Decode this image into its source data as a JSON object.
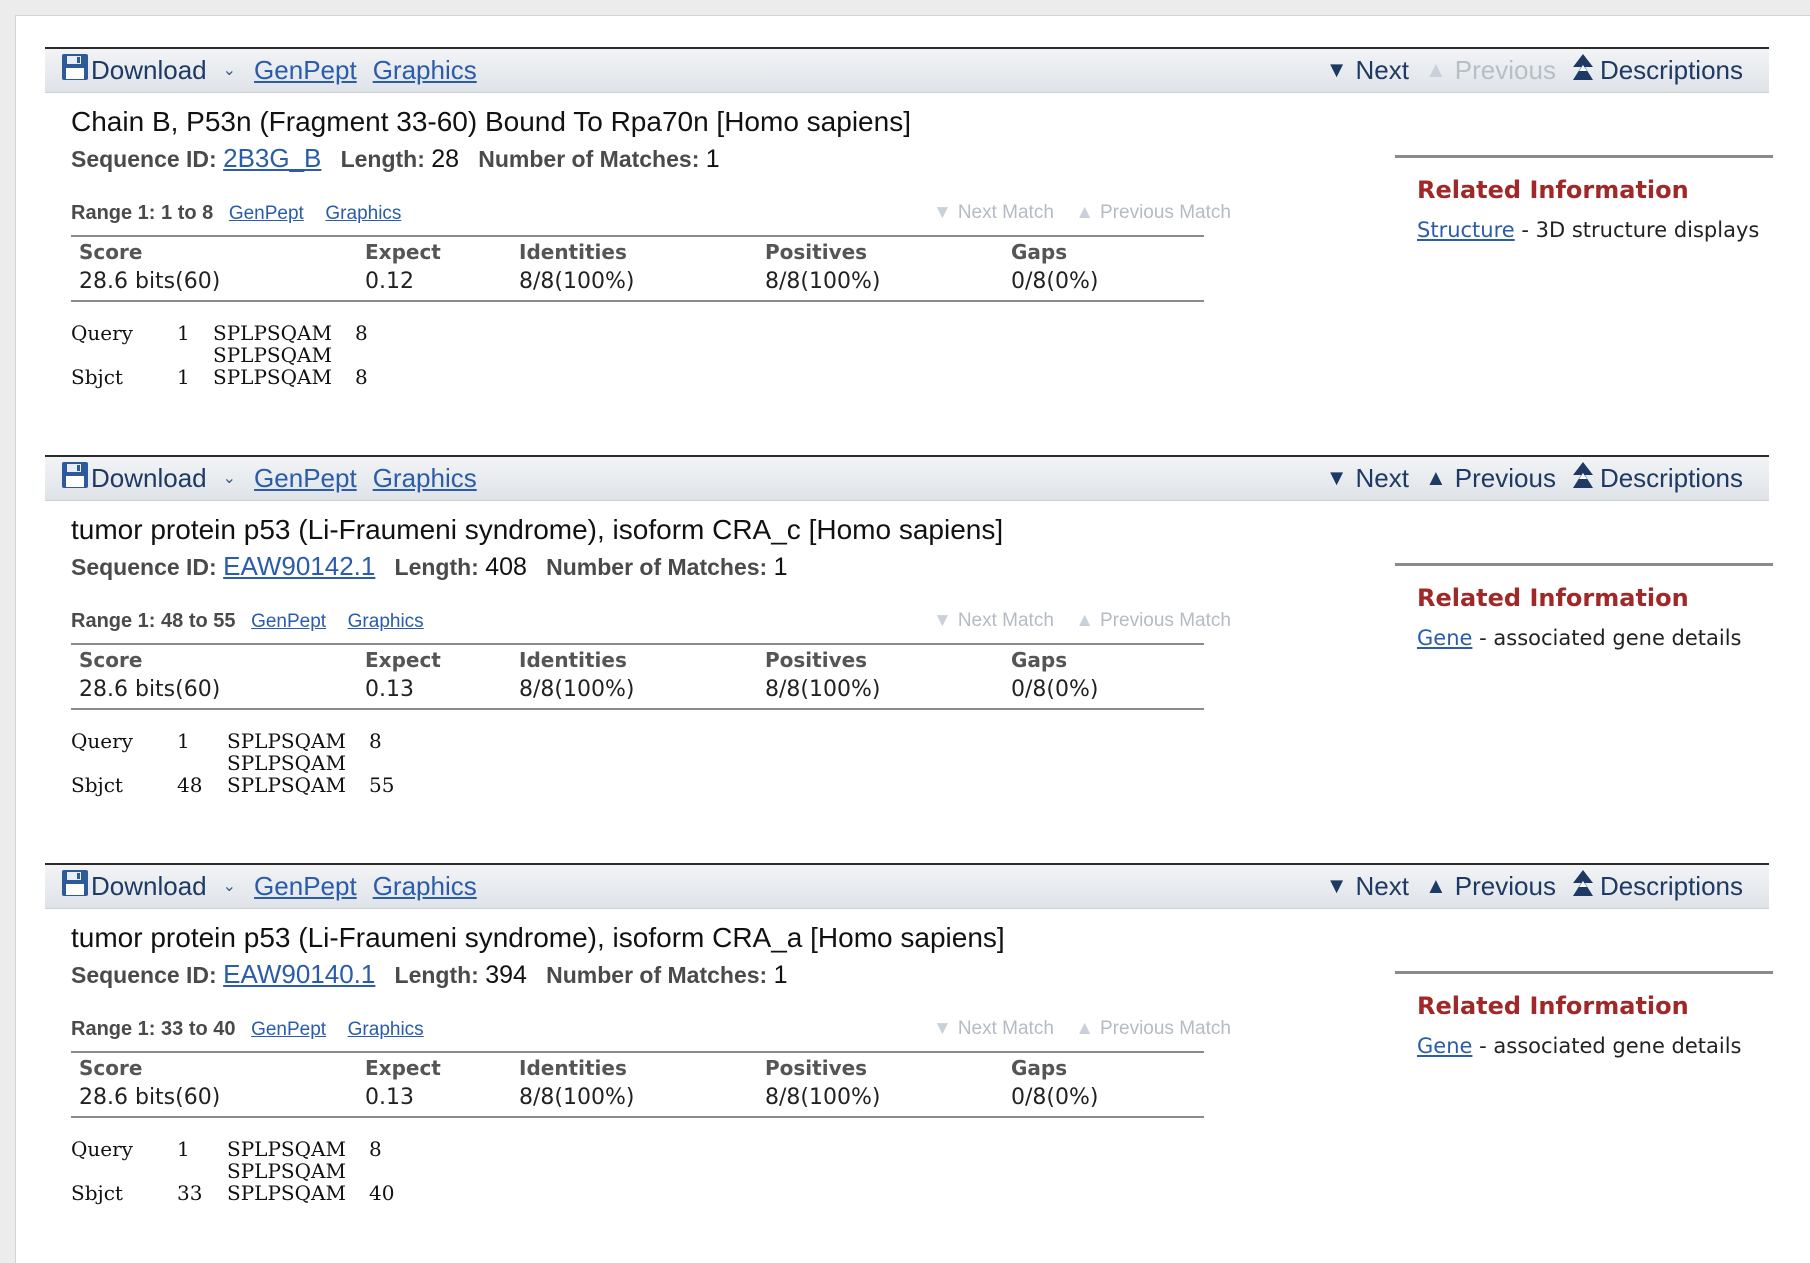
{
  "toolbar": {
    "download_label": "Download",
    "genpept_label": "GenPept",
    "graphics_label": "Graphics",
    "next_label": "Next",
    "previous_label": "Previous",
    "descriptions_label": "Descriptions"
  },
  "labels": {
    "sequence_id": "Sequence ID:",
    "length": "Length:",
    "number_of_matches": "Number of Matches:",
    "next_match": "Next Match",
    "previous_match": "Previous Match",
    "related_information": "Related Information",
    "stat_headers": [
      "Score",
      "Expect",
      "Identities",
      "Positives",
      "Gaps"
    ]
  },
  "colors": {
    "link": "#2a5caa",
    "related_heading": "#a12828",
    "disabled_nav": "#b7bec8"
  },
  "hits": [
    {
      "title": "Chain B, P53n (Fragment 33-60) Bound To Rpa70n [Homo sapiens]",
      "sequence_id": "2B3G_B",
      "length": "28",
      "num_matches": "1",
      "previous_enabled": false,
      "range_label": "Range 1: 1 to 8",
      "range_genpept": "GenPept",
      "range_graphics": "Graphics",
      "score": "28.6 bits(60)",
      "expect": "0.12",
      "identities": "8/8(100%)",
      "positives": "8/8(100%)",
      "gaps": "0/8(0%)",
      "alignment": {
        "query_label": "Query",
        "query_start": "1",
        "query_seq": "SPLPSQAM",
        "query_end": "8",
        "midline": "SPLPSQAM",
        "sbjct_label": "Sbjct",
        "sbjct_start": "1",
        "sbjct_seq": "SPLPSQAM",
        "sbjct_end": "8"
      },
      "related": {
        "link": "Structure",
        "desc": "- 3D structure displays"
      }
    },
    {
      "title": "tumor protein p53 (Li-Fraumeni syndrome), isoform CRA_c [Homo sapiens]",
      "sequence_id": "EAW90142.1",
      "length": "408",
      "num_matches": "1",
      "previous_enabled": true,
      "range_label": "Range 1: 48 to 55",
      "range_genpept": "GenPept",
      "range_graphics": "Graphics",
      "score": "28.6 bits(60)",
      "expect": "0.13",
      "identities": "8/8(100%)",
      "positives": "8/8(100%)",
      "gaps": "0/8(0%)",
      "alignment": {
        "query_label": "Query",
        "query_start": "1",
        "query_seq": "SPLPSQAM",
        "query_end": "8",
        "midline": "SPLPSQAM",
        "sbjct_label": "Sbjct",
        "sbjct_start": "48",
        "sbjct_seq": "SPLPSQAM",
        "sbjct_end": "55"
      },
      "related": {
        "link": "Gene",
        "desc": "- associated gene details"
      }
    },
    {
      "title": "tumor protein p53 (Li-Fraumeni syndrome), isoform CRA_a [Homo sapiens]",
      "sequence_id": "EAW90140.1",
      "length": "394",
      "num_matches": "1",
      "previous_enabled": true,
      "range_label": "Range 1: 33 to 40",
      "range_genpept": "GenPept",
      "range_graphics": "Graphics",
      "score": "28.6 bits(60)",
      "expect": "0.13",
      "identities": "8/8(100%)",
      "positives": "8/8(100%)",
      "gaps": "0/8(0%)",
      "alignment": {
        "query_label": "Query",
        "query_start": "1",
        "query_seq": "SPLPSQAM",
        "query_end": "8",
        "midline": "SPLPSQAM",
        "sbjct_label": "Sbjct",
        "sbjct_start": "33",
        "sbjct_seq": "SPLPSQAM",
        "sbjct_end": "40"
      },
      "related": {
        "link": "Gene",
        "desc": "- associated gene details"
      }
    }
  ]
}
